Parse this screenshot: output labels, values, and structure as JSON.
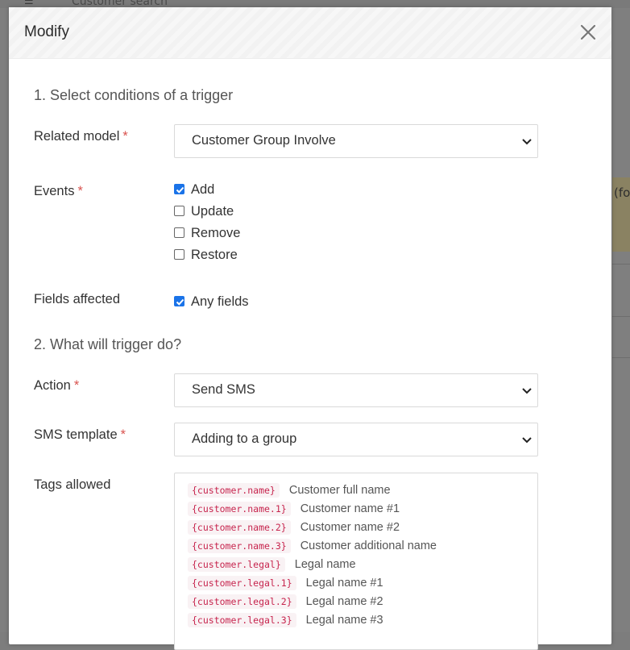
{
  "background": {
    "search_label": "Customer search",
    "peek_text": "(fo"
  },
  "modal": {
    "title": "Modify",
    "close_icon": "close-icon"
  },
  "section1": {
    "title": "1. Select conditions of a trigger",
    "related_model": {
      "label": "Related model",
      "required": "*",
      "value": "Customer Group Involve"
    },
    "events": {
      "label": "Events",
      "required": "*",
      "options": [
        {
          "label": "Add",
          "checked": true
        },
        {
          "label": "Update",
          "checked": false
        },
        {
          "label": "Remove",
          "checked": false
        },
        {
          "label": "Restore",
          "checked": false
        }
      ]
    },
    "fields_affected": {
      "label": "Fields affected",
      "option": {
        "label": "Any fields",
        "checked": true
      }
    }
  },
  "section2": {
    "title": "2. What will trigger do?",
    "action": {
      "label": "Action",
      "required": "*",
      "value": "Send SMS"
    },
    "sms_template": {
      "label": "SMS template",
      "required": "*",
      "value": "Adding to a group"
    },
    "tags_allowed": {
      "label": "Tags allowed",
      "tags": [
        {
          "code": "{customer.name}",
          "desc": "Customer full name"
        },
        {
          "code": "{customer.name.1}",
          "desc": "Customer name #1"
        },
        {
          "code": "{customer.name.2}",
          "desc": "Customer name #2"
        },
        {
          "code": "{customer.name.3}",
          "desc": "Customer additional name"
        },
        {
          "code": "{customer.legal}",
          "desc": "Legal name"
        },
        {
          "code": "{customer.legal.1}",
          "desc": "Legal name #1"
        },
        {
          "code": "{customer.legal.2}",
          "desc": "Legal name #2"
        },
        {
          "code": "{customer.legal.3}",
          "desc": "Legal name #3"
        }
      ]
    }
  },
  "colors": {
    "accent": "#1a73e8",
    "required": "#d9534f",
    "tag_text": "#c7254e",
    "tag_bg": "#f9f2f4"
  }
}
